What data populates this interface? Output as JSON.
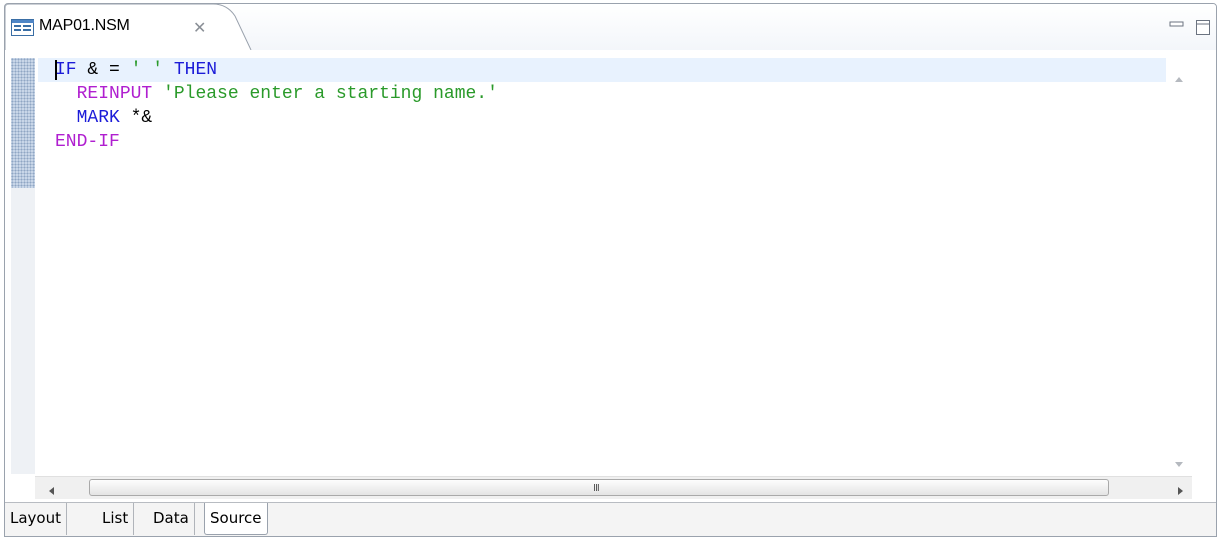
{
  "tab": {
    "title": "MAP01.NSM",
    "close_glyph": "✕"
  },
  "window_controls": {
    "minimize_icon": "minimize-icon",
    "maximize_icon": "maximize-icon"
  },
  "code_lines": [
    {
      "tokens": [
        {
          "text": "IF",
          "style": "kw-blue"
        },
        {
          "text": " & = ",
          "style": "plain"
        },
        {
          "text": "' '",
          "style": "str"
        },
        {
          "text": " ",
          "style": "plain"
        },
        {
          "text": "THEN",
          "style": "kw-blue"
        }
      ]
    },
    {
      "tokens": [
        {
          "text": "  ",
          "style": "plain"
        },
        {
          "text": "REINPUT",
          "style": "kw-purple"
        },
        {
          "text": " ",
          "style": "plain"
        },
        {
          "text": "'Please enter a starting name.'",
          "style": "str"
        }
      ]
    },
    {
      "tokens": [
        {
          "text": "  ",
          "style": "plain"
        },
        {
          "text": "MARK",
          "style": "kw-blue"
        },
        {
          "text": " *&",
          "style": "plain"
        }
      ]
    },
    {
      "tokens": [
        {
          "text": "END-IF",
          "style": "kw-purple"
        }
      ]
    }
  ],
  "scrollbar": {
    "grip": "III"
  },
  "bottom_tabs": [
    {
      "label": "Layout",
      "active": false
    },
    {
      "label": "List",
      "active": false
    },
    {
      "label": "Data",
      "active": false
    },
    {
      "label": "Source",
      "active": true
    }
  ],
  "colors": {
    "keyword_blue": "#1c1cd8",
    "keyword_purple": "#b01fd0",
    "string_green": "#2a9a2a",
    "current_line": "#e8f2fe"
  }
}
